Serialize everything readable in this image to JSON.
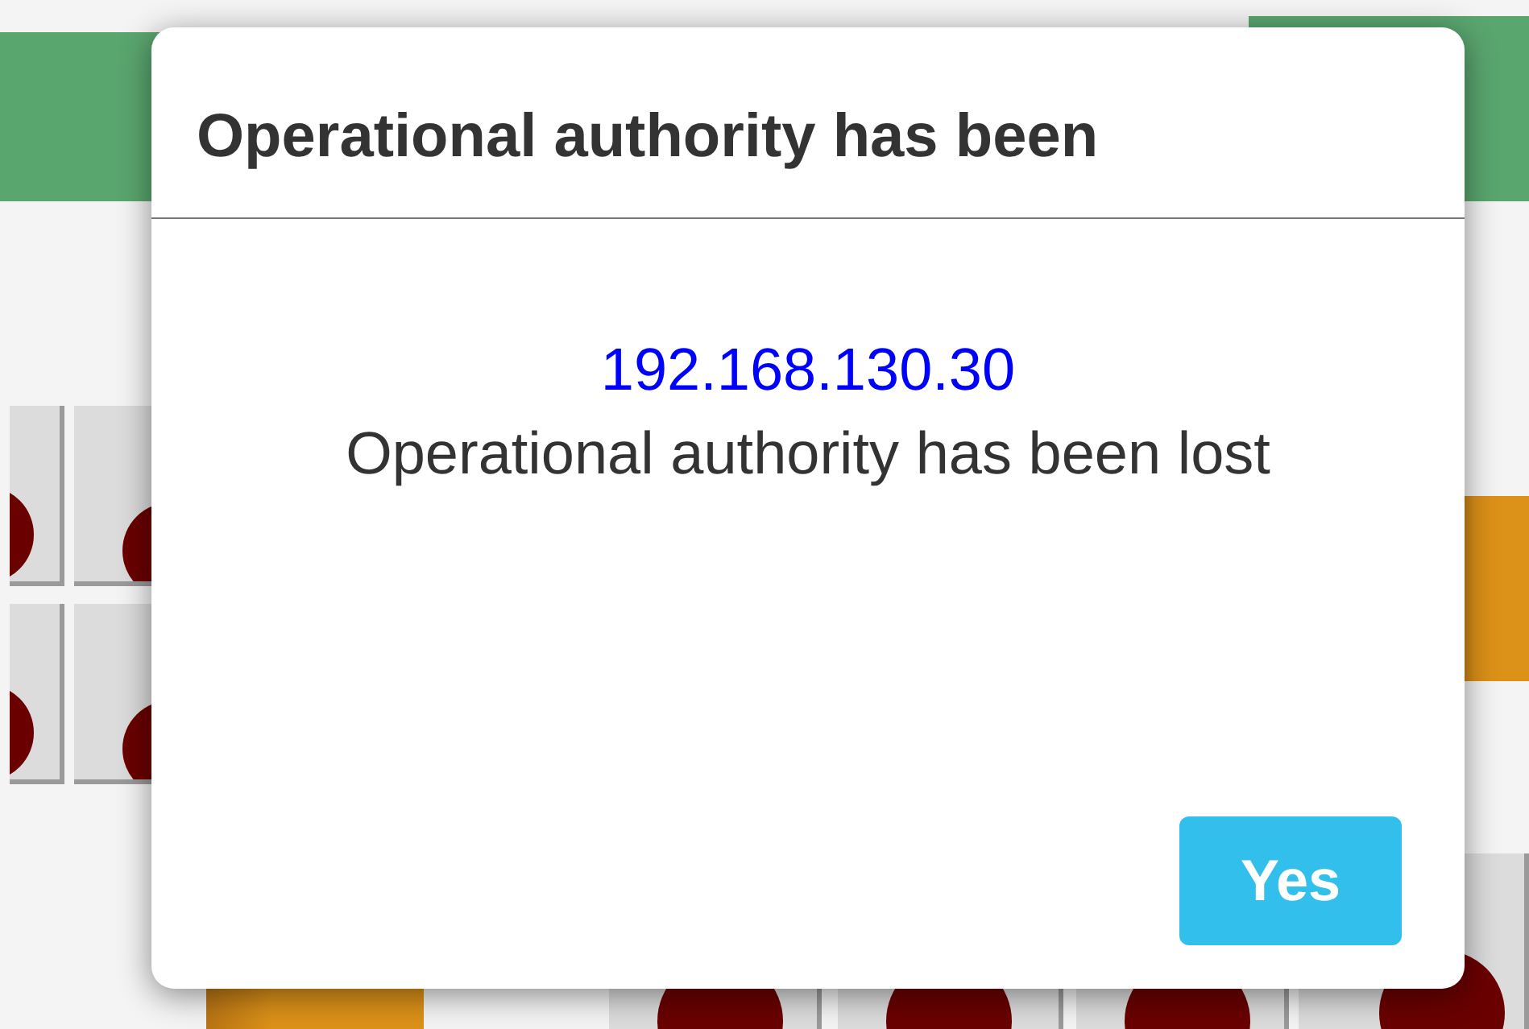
{
  "dialog": {
    "title": "Operational authority has been",
    "address": "192.168.130.30",
    "message": "Operational authority has been lost",
    "buttons": [
      "Yes"
    ]
  }
}
